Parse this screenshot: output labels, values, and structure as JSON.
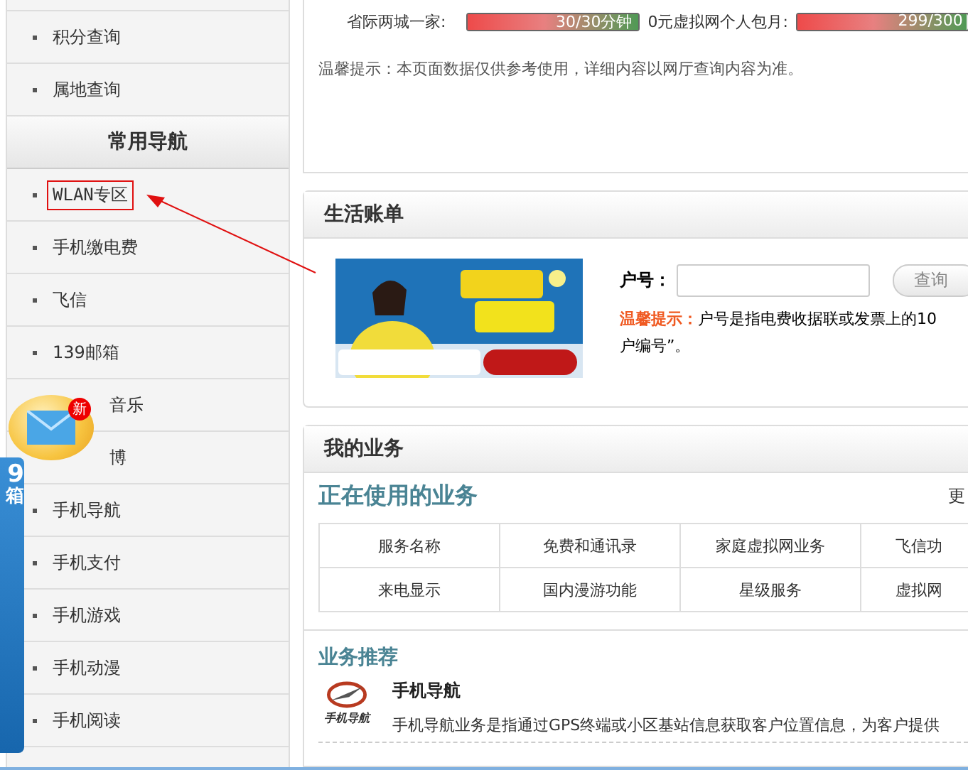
{
  "sidebar": {
    "items": [
      {
        "kind": "link",
        "label": "积分查询",
        "highlighted": false
      },
      {
        "kind": "link",
        "label": "属地查询",
        "highlighted": false
      },
      {
        "kind": "header",
        "label": "常用导航"
      },
      {
        "kind": "link",
        "label": "WLAN专区",
        "highlighted": true
      },
      {
        "kind": "link",
        "label": "手机缴电费",
        "highlighted": false
      },
      {
        "kind": "link",
        "label": "飞信",
        "highlighted": false
      },
      {
        "kind": "link",
        "label": "139邮箱",
        "highlighted": false
      },
      {
        "kind": "partial",
        "label": "音乐"
      },
      {
        "kind": "partial",
        "label": "博"
      },
      {
        "kind": "link",
        "label": "手机导航",
        "highlighted": false
      },
      {
        "kind": "link",
        "label": "手机支付",
        "highlighted": false
      },
      {
        "kind": "link",
        "label": "手机游戏",
        "highlighted": false
      },
      {
        "kind": "link",
        "label": "手机动漫",
        "highlighted": false
      },
      {
        "kind": "link",
        "label": "手机阅读",
        "highlighted": false
      }
    ]
  },
  "mail_widget": {
    "badge": "新",
    "panel_texts": [
      "9",
      "箱"
    ]
  },
  "usage": {
    "meters": [
      {
        "label": "省际两城一家:",
        "reading": "30/30分钟",
        "level": 1
      },
      {
        "label": "0元虚拟网个人包月:",
        "reading": "299/300",
        "level": 0.99
      }
    ],
    "note": "温馨提示：本页面数据仅供参考使用，详细内容以网厅查询内容为准。"
  },
  "bill": {
    "title": "生活账单",
    "field_label": "户号：",
    "button": "查询",
    "tip_label": "温馨提示：",
    "tip_lines": [
      "户号是指电费收据联或发票上的10",
      "户编号”。"
    ]
  },
  "business": {
    "title": "我的业务",
    "in_use_title": "正在使用的业务",
    "more": "更",
    "table": {
      "rows": [
        [
          "服务名称",
          "免费和通讯录",
          "家庭虚拟网业务",
          "飞信功"
        ],
        [
          "来电显示",
          "国内漫游功能",
          "星级服务",
          "虚拟网"
        ]
      ]
    },
    "recommend_title": "业务推荐",
    "recommend": {
      "name": "手机导航",
      "logo_caption": "手机导航",
      "description": "手机导航业务是指通过GPS终端或小区基站信息获取客户位置信息，为客户提供"
    }
  }
}
